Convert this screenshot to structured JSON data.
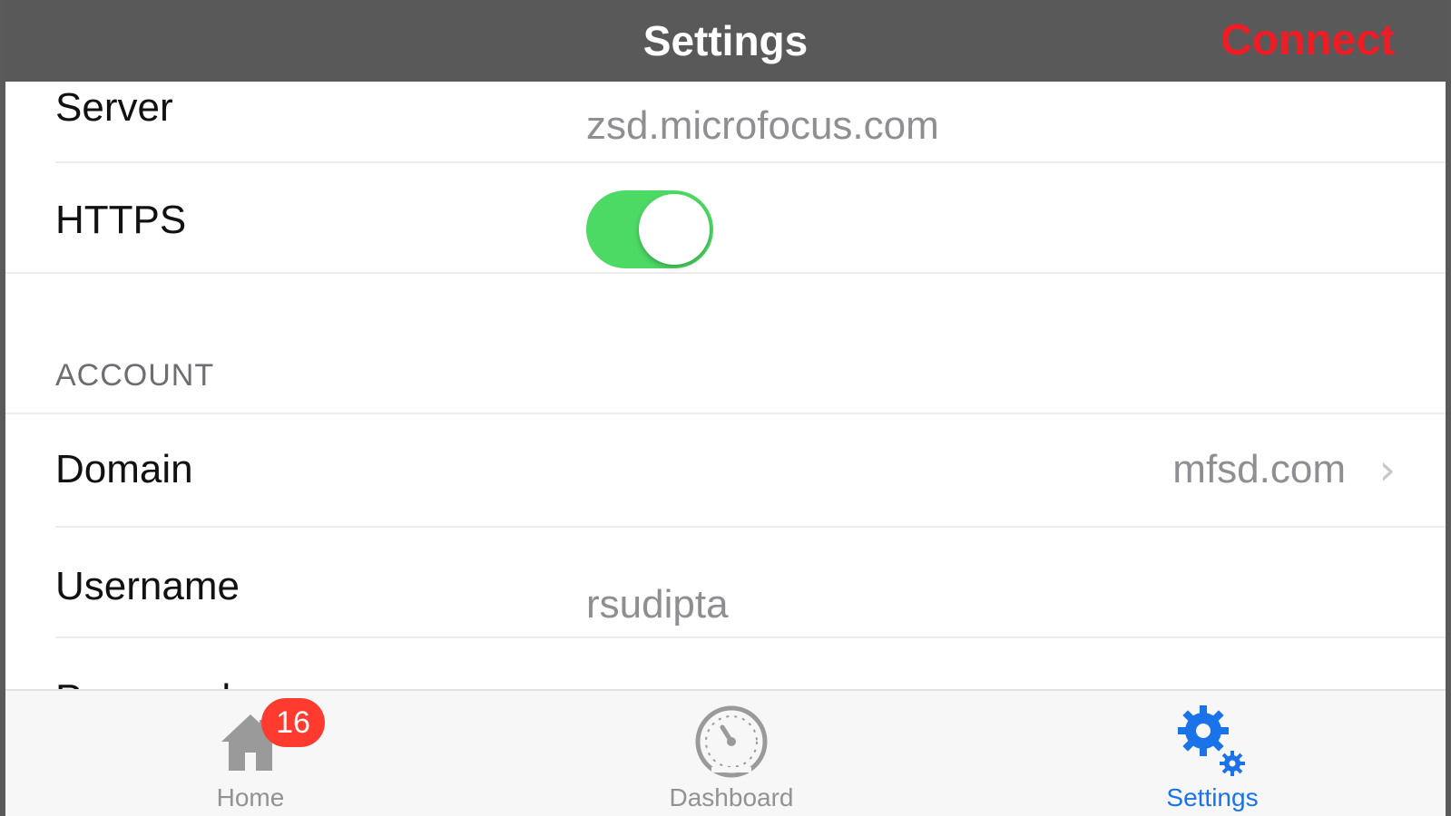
{
  "navbar": {
    "title": "Settings",
    "connect_label": "Connect",
    "title_color": "#ffffff",
    "connect_color": "#ee1c25",
    "background": "#595959"
  },
  "server_section": {
    "server": {
      "label": "Server",
      "value": "zsd.microfocus.com"
    },
    "https": {
      "label": "HTTPS",
      "enabled": true
    }
  },
  "account_section": {
    "header": "ACCOUNT",
    "domain": {
      "label": "Domain",
      "value": "mfsd.com"
    },
    "username": {
      "label": "Username",
      "value": "rsudipta"
    },
    "password": {
      "label": "Password"
    }
  },
  "tabbar": {
    "tabs": [
      {
        "label": "Home",
        "icon": "home-icon",
        "badge": "16",
        "active": false
      },
      {
        "label": "Dashboard",
        "icon": "dashboard-gauge-icon",
        "active": false
      },
      {
        "label": "Settings",
        "icon": "settings-gears-icon",
        "active": true
      }
    ],
    "active_color": "#1a73e8",
    "inactive_color": "#929292",
    "badge_color": "#ff3b30"
  },
  "colors": {
    "toggle_on": "#4cd964",
    "value_text": "#8e8e93"
  }
}
